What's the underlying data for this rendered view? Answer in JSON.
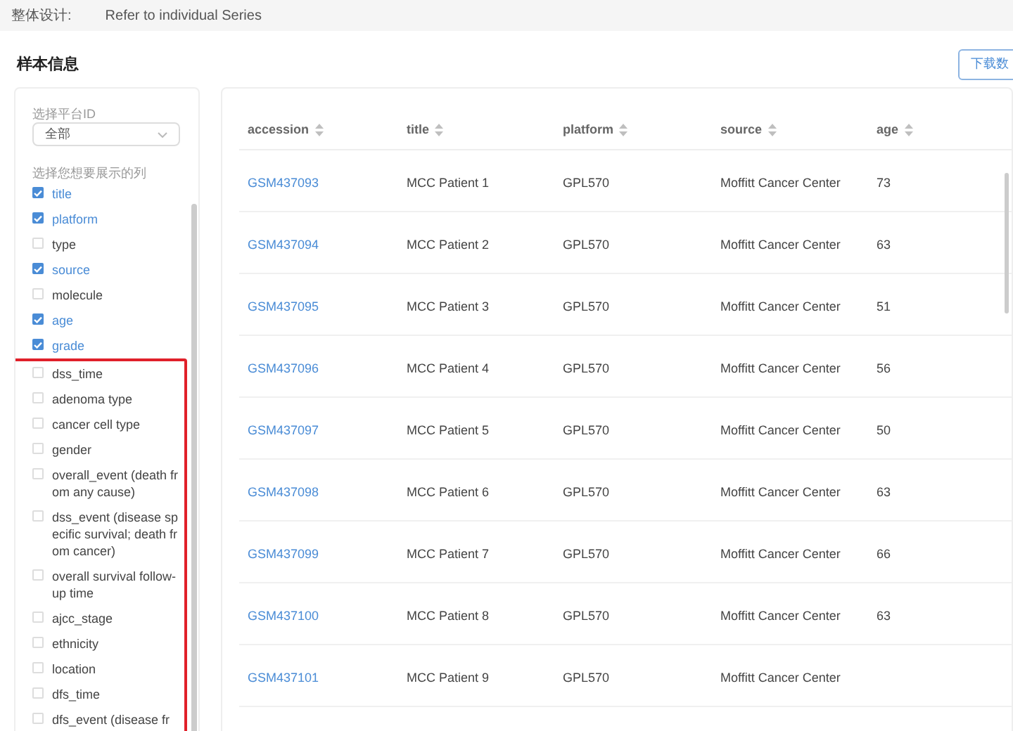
{
  "top_bar": {
    "label": "整体设计:",
    "value": "Refer to individual Series"
  },
  "section_title": "样本信息",
  "download_button": "下载数",
  "filters": {
    "platform_label": "选择平台ID",
    "platform_select": {
      "value": "全部"
    },
    "columns_label": "选择您想要展示的列",
    "columns": [
      {
        "label": "title",
        "checked": true
      },
      {
        "label": "platform",
        "checked": true
      },
      {
        "label": "type",
        "checked": false
      },
      {
        "label": "source",
        "checked": true
      },
      {
        "label": "molecule",
        "checked": false
      },
      {
        "label": "age",
        "checked": true
      },
      {
        "label": "grade",
        "checked": true
      }
    ],
    "highlighted_columns": [
      {
        "label": "dss_time",
        "checked": false
      },
      {
        "label": "adenoma type",
        "checked": false
      },
      {
        "label": "cancer cell type",
        "checked": false
      },
      {
        "label": "gender",
        "checked": false
      },
      {
        "label": "overall_event (death from any cause)",
        "checked": false
      },
      {
        "label": "dss_event (disease specific survival; death from cancer)",
        "checked": false
      },
      {
        "label": "overall survival follow-up time",
        "checked": false
      },
      {
        "label": "ajcc_stage",
        "checked": false
      },
      {
        "label": "ethnicity",
        "checked": false
      },
      {
        "label": "location",
        "checked": false
      },
      {
        "label": "dfs_time",
        "checked": false
      },
      {
        "label": "dfs_event (disease fr",
        "checked": false
      }
    ]
  },
  "table": {
    "columns": [
      "accession",
      "title",
      "platform",
      "source",
      "age"
    ],
    "rows": [
      [
        "GSM437093",
        "MCC Patient 1",
        "GPL570",
        "Moffitt Cancer Center",
        "73"
      ],
      [
        "GSM437094",
        "MCC Patient 2",
        "GPL570",
        "Moffitt Cancer Center",
        "63"
      ],
      [
        "GSM437095",
        "MCC Patient 3",
        "GPL570",
        "Moffitt Cancer Center",
        "51"
      ],
      [
        "GSM437096",
        "MCC Patient 4",
        "GPL570",
        "Moffitt Cancer Center",
        "56"
      ],
      [
        "GSM437097",
        "MCC Patient 5",
        "GPL570",
        "Moffitt Cancer Center",
        "50"
      ],
      [
        "GSM437098",
        "MCC Patient 6",
        "GPL570",
        "Moffitt Cancer Center",
        "63"
      ],
      [
        "GSM437099",
        "MCC Patient 7",
        "GPL570",
        "Moffitt Cancer Center",
        "66"
      ],
      [
        "GSM437100",
        "MCC Patient 8",
        "GPL570",
        "Moffitt Cancer Center",
        "63"
      ],
      [
        "GSM437101",
        "MCC Patient 9",
        "GPL570",
        "Moffitt Cancer Center"
      ]
    ]
  }
}
